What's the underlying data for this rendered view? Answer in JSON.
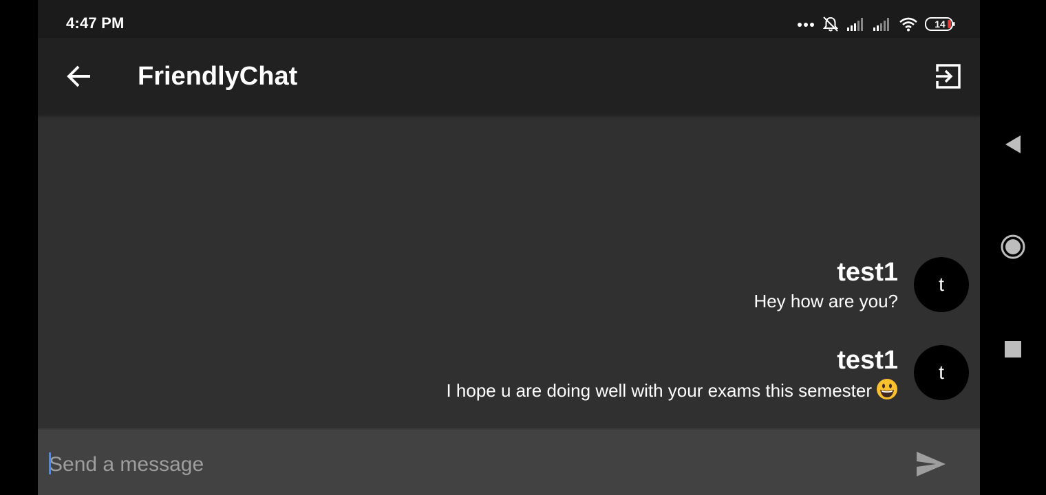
{
  "status_bar": {
    "time": "4:47 PM",
    "battery_level": "14",
    "icons": [
      "more-dots-icon",
      "alarm-off-icon",
      "signal-icon",
      "signal-icon",
      "wifi-icon",
      "battery-icon"
    ]
  },
  "app_bar": {
    "title": "FriendlyChat",
    "back_icon": "arrow-back-icon",
    "logout_icon": "exit-to-app-icon"
  },
  "messages": [
    {
      "sender": "test1",
      "text": "Hey how are you?",
      "avatar_letter": "t"
    },
    {
      "sender": "test1",
      "text": "I hope u are doing well with your exams this semester",
      "emoji": "😃",
      "avatar_letter": "t"
    }
  ],
  "composer": {
    "placeholder": "Send a message",
    "value": "",
    "send_icon": "send-icon"
  },
  "nav_bar": {
    "buttons": [
      "back-triangle-icon",
      "home-circle-icon",
      "recents-square-icon"
    ]
  },
  "colors": {
    "app_bar": "#212121",
    "background": "#303030",
    "composer": "#424242",
    "accent": "#448aff",
    "avatar": "#000000"
  }
}
